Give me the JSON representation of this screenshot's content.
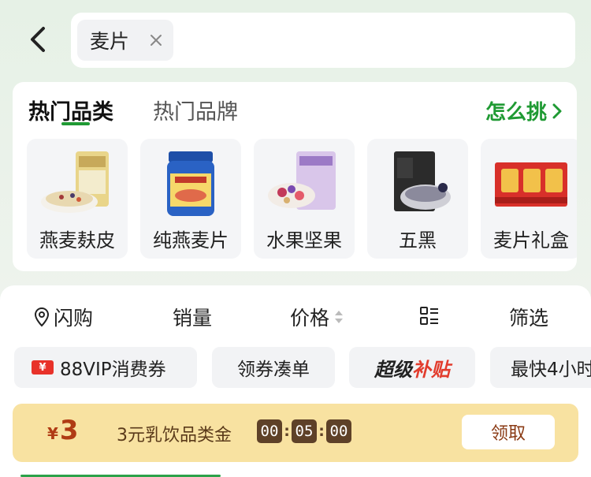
{
  "header": {
    "back_icon": "chevron-left-icon",
    "search": {
      "query": "麦片",
      "clear_icon": "close-icon"
    }
  },
  "categories_card": {
    "tabs": [
      {
        "label": "热门品类",
        "active": true
      },
      {
        "label": "热门品牌",
        "active": false
      }
    ],
    "how_to_choose": "怎么挑",
    "items": [
      {
        "label": "燕麦麸皮"
      },
      {
        "label": "纯燕麦片"
      },
      {
        "label": "水果坚果"
      },
      {
        "label": "五黑"
      },
      {
        "label": "麦片礼盒"
      }
    ]
  },
  "sort_bar": {
    "flash": "闪购",
    "sales": "销量",
    "price": "价格",
    "layout_icon": "grid-list-icon",
    "filter": "筛选"
  },
  "chips": {
    "vip_badge": "¥",
    "vip": "88VIP消费券",
    "coupon": "领券凑单",
    "subsidy_part1": "超级",
    "subsidy_part2": "补贴",
    "fast": "最快4小时"
  },
  "promo": {
    "currency": "¥",
    "amount": "3",
    "description": "3元乳饮品类金",
    "timer": {
      "h": "00",
      "m": "05",
      "s": "00"
    },
    "claim": "领取"
  },
  "colors": {
    "accent_green": "#1f9a33",
    "promo_bg": "#f8e2a1",
    "timer_bg": "#5e4128",
    "vip_red": "#e8322a"
  }
}
